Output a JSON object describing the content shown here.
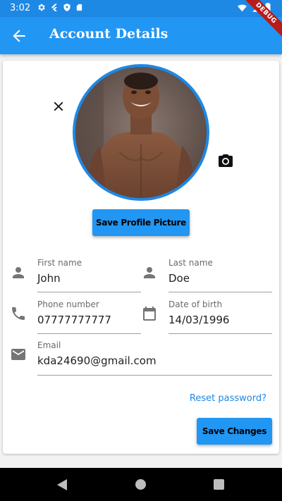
{
  "status_bar": {
    "time": "3:02",
    "left_icons": [
      "gear-icon",
      "flutter-icon",
      "shield-icon",
      "sd-card-icon"
    ],
    "right_icons": [
      "wifi-icon",
      "signal-icon",
      "battery-icon"
    ]
  },
  "debug_banner": {
    "label": "DEBUG"
  },
  "app_bar": {
    "title": "Account Details",
    "back_icon": "arrow-back-icon"
  },
  "profile": {
    "remove_icon": "close-icon",
    "camera_icon": "camera-icon",
    "save_picture_label": "Save Profile Picture"
  },
  "form": {
    "first_name": {
      "label": "First name",
      "value": "John",
      "icon": "person-icon"
    },
    "last_name": {
      "label": "Last name",
      "value": "Doe",
      "icon": "person-icon"
    },
    "phone": {
      "label": "Phone number",
      "value": "07777777777",
      "icon": "phone-icon"
    },
    "dob": {
      "label": "Date of birth",
      "value": "14/03/1996",
      "icon": "calendar-icon"
    },
    "email": {
      "label": "Email",
      "value": "kda24690@gmail.com",
      "icon": "email-icon"
    }
  },
  "actions": {
    "reset_password": "Reset password?",
    "save_changes": "Save Changes"
  },
  "colors": {
    "primary": "#2196f3",
    "status_bar": "#1e88e5",
    "avatar_border": "#1e88e5",
    "debug_ribbon": "#b71c1c"
  },
  "nav_bar": {
    "icons": [
      "nav-back-icon",
      "nav-home-icon",
      "nav-recents-icon"
    ]
  }
}
